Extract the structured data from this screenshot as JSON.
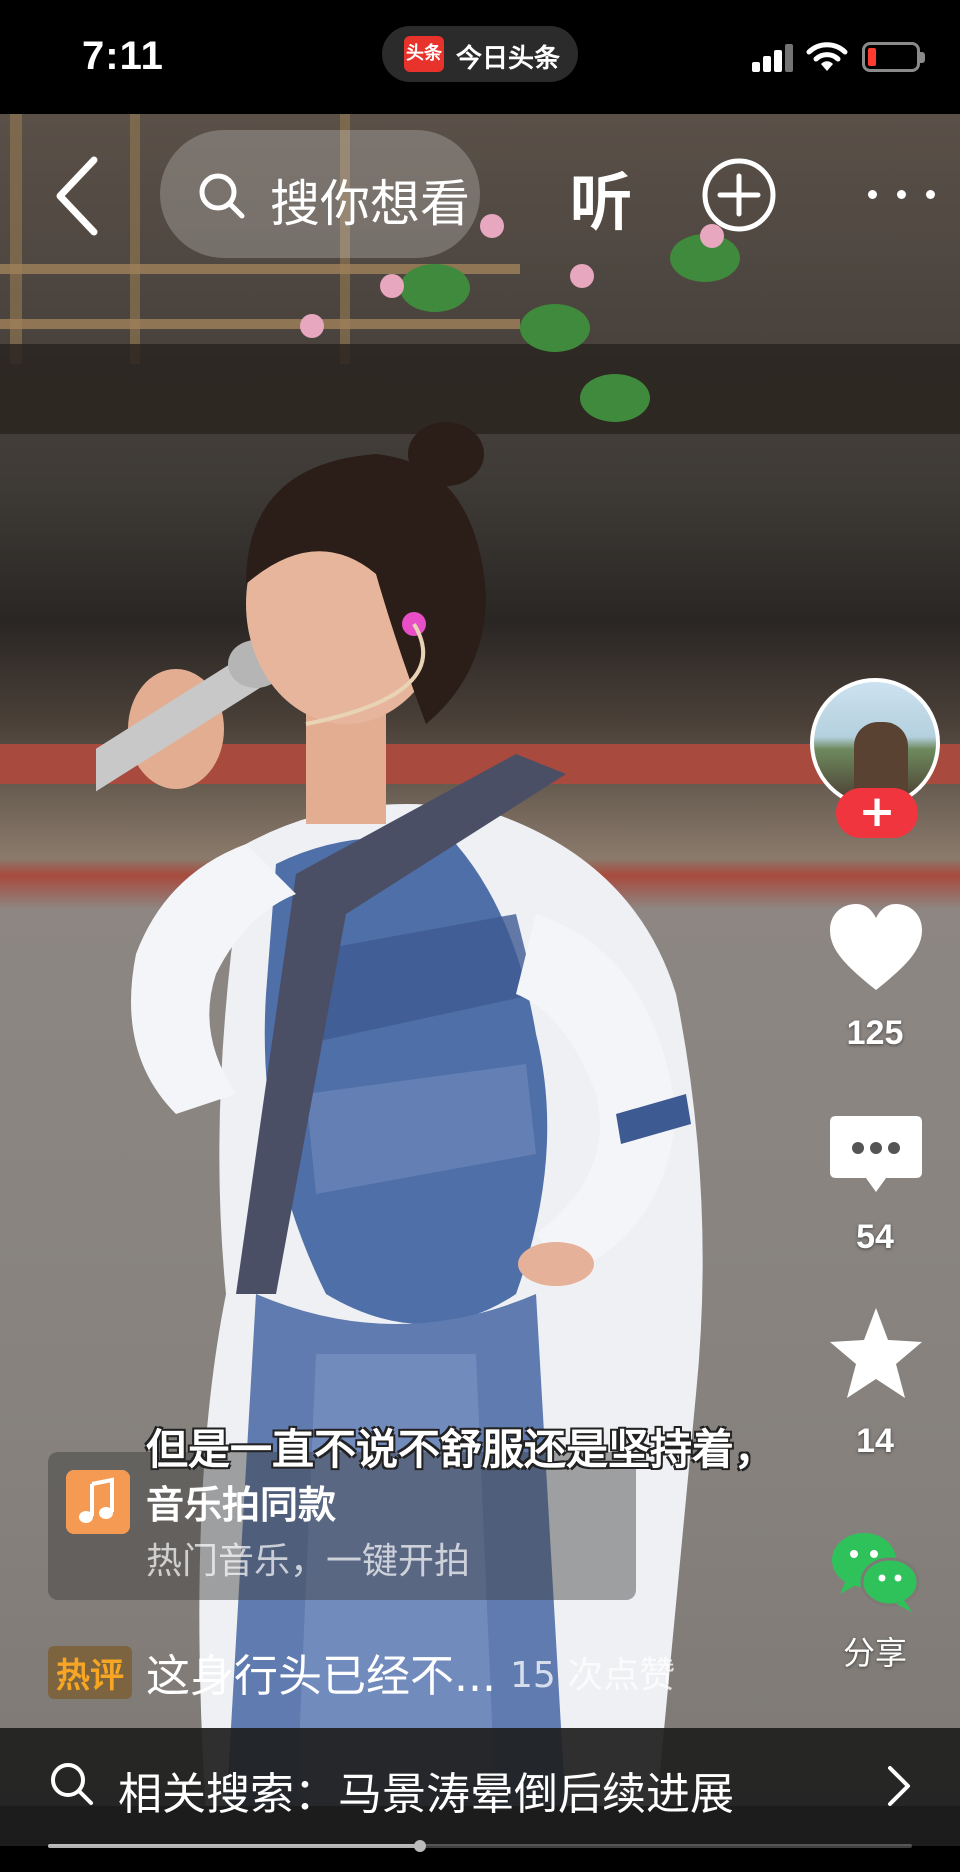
{
  "status_bar": {
    "time": "7:11",
    "app_logo_text": "头条",
    "app_name": "今日头条",
    "battery_color": "#ff3b30"
  },
  "top_nav": {
    "back_icon": "chevron-left-icon",
    "search_placeholder": "搜你想看",
    "listen_label": "听",
    "add_icon": "plus-circle-icon",
    "more_icon": "more-dots-icon"
  },
  "actions": {
    "follow_label": "+",
    "like_count": "125",
    "comment_count": "54",
    "favorite_count": "14",
    "share_label": "分享",
    "follow_color": "#f0353f",
    "share_color": "#2fc25b"
  },
  "subtitle": "但是一直不说不舒服还是坚持着，",
  "music_card": {
    "icon": "music-note-icon",
    "title": "音乐拍同款",
    "subtitle": "热门音乐，一键开拍"
  },
  "hot_comment": {
    "tag": "热评",
    "text": "这身行头已经不...",
    "likes": "15 次点赞",
    "tag_color": "#f6a623"
  },
  "related_search": {
    "text": "相关搜索：马景涛晕倒后续进展"
  },
  "playback": {
    "progress": 0.43
  }
}
